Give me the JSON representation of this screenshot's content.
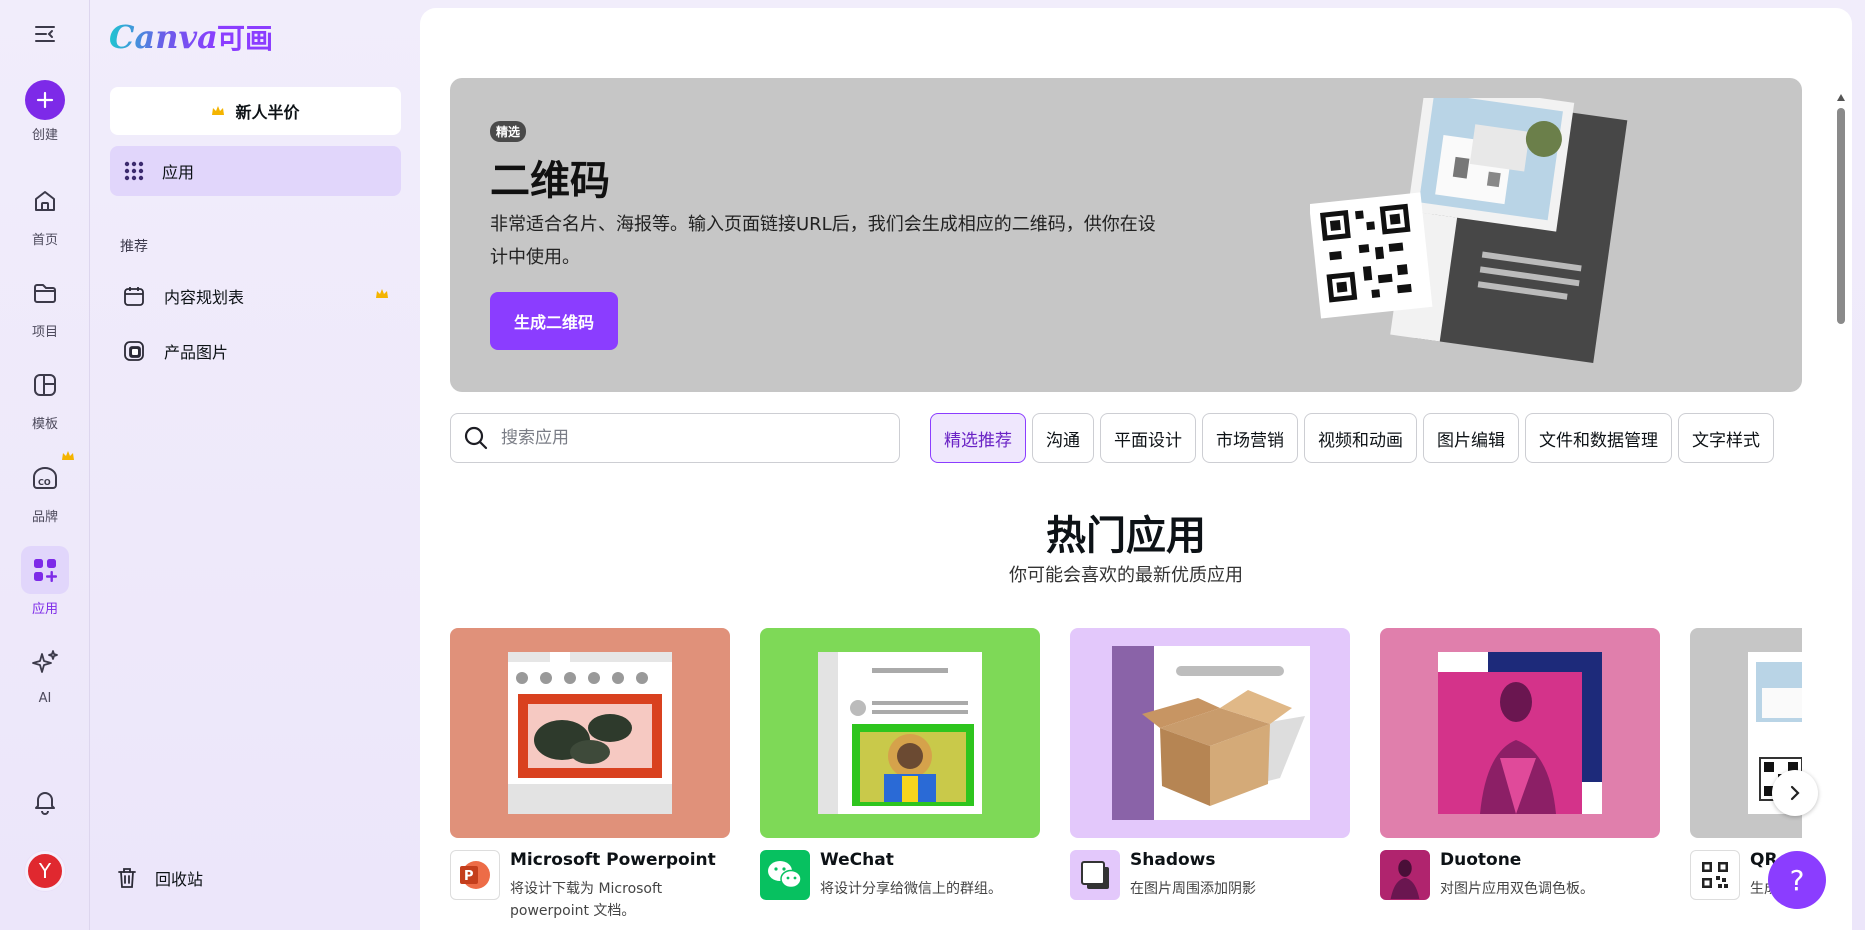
{
  "brand": {
    "logo_text": "Canva",
    "logo_cn": "可画",
    "accent": "#8b3dff"
  },
  "rail": {
    "create_label": "创建",
    "items": [
      {
        "label": "首页",
        "icon": "home-icon"
      },
      {
        "label": "项目",
        "icon": "folder-icon"
      },
      {
        "label": "模板",
        "icon": "template-icon"
      },
      {
        "label": "品牌",
        "icon": "brand-icon"
      },
      {
        "label": "应用",
        "icon": "apps-icon"
      },
      {
        "label": "AI",
        "icon": "sparkle-icon"
      }
    ],
    "avatar_initial": "Y"
  },
  "panel": {
    "promo_label": "新人半价",
    "apps_label": "应用",
    "section_label": "推荐",
    "items": [
      {
        "label": "内容规划表",
        "icon": "calendar-icon"
      },
      {
        "label": "产品图片",
        "icon": "product-photo-icon"
      }
    ],
    "trash_label": "回收站"
  },
  "hero": {
    "badge": "精选",
    "title": "二维码",
    "description": "非常适合名片、海报等。输入页面链接URL后，我们会生成相应的二维码，供你在设计中使用。",
    "button_label": "生成二维码"
  },
  "search": {
    "placeholder": "搜索应用",
    "value": ""
  },
  "chips": [
    "精选推荐",
    "沟通",
    "平面设计",
    "市场营销",
    "视频和动画",
    "图片编辑",
    "文件和数据管理",
    "文字样式"
  ],
  "section": {
    "title": "热门应用",
    "subtitle": "你可能会喜欢的最新优质应用"
  },
  "apps": [
    {
      "name": "Microsoft Powerpoint",
      "desc": "将设计下载为 Microsoft powerpoint 文档。",
      "bg": "#e0917a"
    },
    {
      "name": "WeChat",
      "desc": "将设计分享给微信上的群组。",
      "bg": "#7ed957"
    },
    {
      "name": "Shadows",
      "desc": "在图片周围添加阴影",
      "bg": "#e3c8fb"
    },
    {
      "name": "Duotone",
      "desc": "对图片应用双色调色板。",
      "bg": "#e07fac"
    },
    {
      "name": "QR",
      "desc": "生成二维码供你在设计中分享",
      "bg": "#c6c6c6"
    }
  ],
  "help_label": "?"
}
